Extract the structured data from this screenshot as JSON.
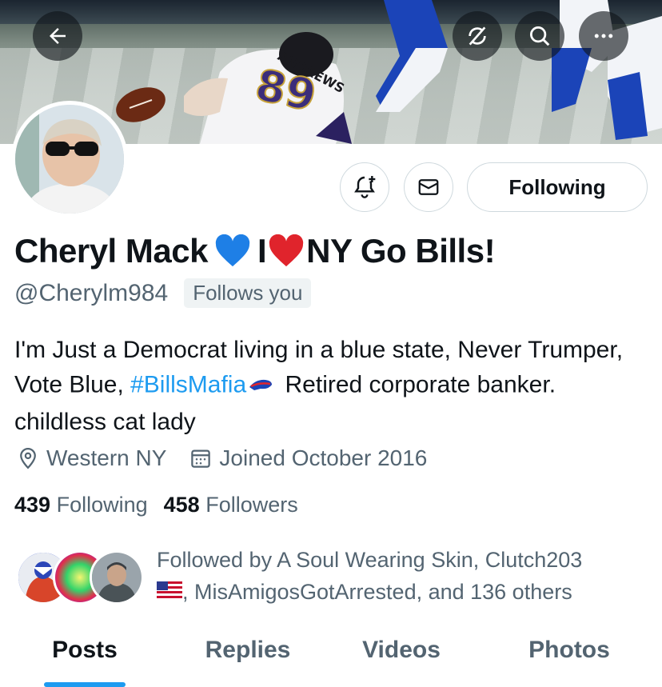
{
  "header": {
    "back_icon": "arrow-left-icon",
    "sync_icon": "sync-off-icon",
    "search_icon": "search-icon",
    "more_icon": "more-horizontal-icon",
    "banner_jersey_name": "ANDREWS",
    "banner_jersey_number": "89"
  },
  "actions": {
    "notify_icon": "bell-plus-icon",
    "message_icon": "envelope-icon",
    "following_label": "Following"
  },
  "profile": {
    "name_part1": "Cheryl Mack",
    "name_part2": "I",
    "name_part3": "NY Go Bills!",
    "handle": "@Cherylm984",
    "follows_you": "Follows you",
    "bio_part1": "I'm Just a Democrat living in a blue state, Never Trumper, Vote Blue, ",
    "bio_hashtag": "#BillsMafia",
    "bio_part2": " Retired corporate banker. childless cat lady",
    "location": "Western NY",
    "joined": "Joined October 2016",
    "following_count": "439",
    "following_label": "Following",
    "followers_count": "458",
    "followers_label": "Followers",
    "followed_by_line1": "Followed by A Soul Wearing Skin, Clutch203",
    "followed_by_line2": ", MisAmigosGotArrested, and 136 others"
  },
  "tabs": [
    {
      "label": "Posts",
      "active": true
    },
    {
      "label": "Replies",
      "active": false
    },
    {
      "label": "Videos",
      "active": false
    },
    {
      "label": "Photos",
      "active": false
    }
  ],
  "colors": {
    "accent": "#1d9bf0",
    "text": "#0f1419",
    "muted": "#536471",
    "border": "#cfd9de",
    "heart": "#e0242c",
    "blue_heart": "#1e7fe6"
  }
}
